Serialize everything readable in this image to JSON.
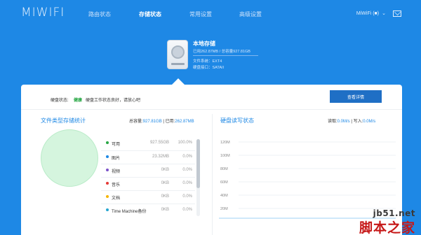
{
  "app": {
    "logo": "MIWIFI"
  },
  "nav": {
    "items": [
      {
        "label": "路由状态",
        "active": false
      },
      {
        "label": "存储状态",
        "active": true
      },
      {
        "label": "常用设置",
        "active": false
      },
      {
        "label": "高级设置",
        "active": false
      }
    ],
    "user": "MiWiFi (■)",
    "icons": {
      "user_menu": "chevron-down-icon",
      "mail": "mail-icon"
    }
  },
  "disk": {
    "title": "本地存储",
    "usage": "已用262.87MB / 总容量927.81GB",
    "filesystem": "文件系统：EXT4",
    "interface": "硬盘接口：SATAII",
    "icon": "hard-drive-icon"
  },
  "status": {
    "label": "硬盘状态:",
    "value": "健康",
    "description": "硬盘工作状态良好，请放心吧",
    "detail_button": "查看详情",
    "color_ok": "#28a745"
  },
  "storage_stats": {
    "title": "文件类型存储统计",
    "total_label": "总容量:",
    "total_value": "927.81GB",
    "used_label": "| 已用:",
    "used_value": "262.87MB",
    "types": [
      {
        "name": "可用",
        "size": "927.55GB",
        "pct": "100.0%",
        "color": "#28a745"
      },
      {
        "name": "图片",
        "size": "23.32MB",
        "pct": "0.0%",
        "color": "#1e88e5"
      },
      {
        "name": "视频",
        "size": "0KB",
        "pct": "0.0%",
        "color": "#7b52c9"
      },
      {
        "name": "音乐",
        "size": "0KB",
        "pct": "0.0%",
        "color": "#e53935"
      },
      {
        "name": "文档",
        "size": "0KB",
        "pct": "0.0%",
        "color": "#f5b400"
      },
      {
        "name": "Time Machine备份",
        "size": "0KB",
        "pct": "0.0%",
        "color": "#26a6d1"
      }
    ]
  },
  "disk_io": {
    "title": "硬盘读写状态",
    "read_label": "读取:",
    "read_value": "0.0M/s",
    "write_label": "| 写入:",
    "write_value": "0.0M/s",
    "y_ticks": [
      "120M",
      "100M",
      "80M",
      "60M",
      "40M",
      "20M"
    ]
  },
  "colors": {
    "brand": "#1e88e5",
    "button": "#1f6fc5"
  },
  "watermark": {
    "site": "jb51.net",
    "brand": "脚本之家"
  }
}
